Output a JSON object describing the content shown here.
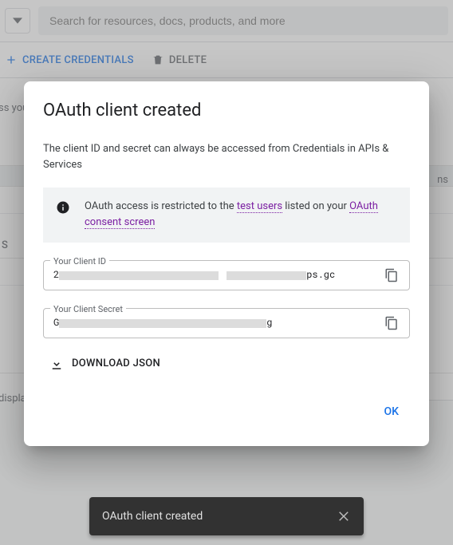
{
  "search": {
    "placeholder": "Search for resources, docs, products, and more"
  },
  "toolbar": {
    "create_label": "CREATE CREDENTIALS",
    "delete_label": "DELETE"
  },
  "bg_fragments": {
    "ss_you": "ss you",
    "ns": "ns",
    "S": "S",
    "displa": "displa"
  },
  "dialog": {
    "title": "OAuth client created",
    "intro": "The client ID and secret can always be accessed from Credentials in APIs & Services",
    "info_prefix": "OAuth access is restricted to the ",
    "test_users_link": "test users",
    "info_mid": " listed on your ",
    "consent_link": "OAuth consent screen",
    "client_id_label": "Your Client ID",
    "client_id_prefix": "2",
    "client_id_suffix": "ps.gc",
    "client_secret_label": "Your Client Secret",
    "client_secret_prefix": "G",
    "client_secret_suffix": "g",
    "download_label": "DOWNLOAD JSON",
    "ok_label": "OK"
  },
  "snackbar": {
    "message": "OAuth client created"
  }
}
